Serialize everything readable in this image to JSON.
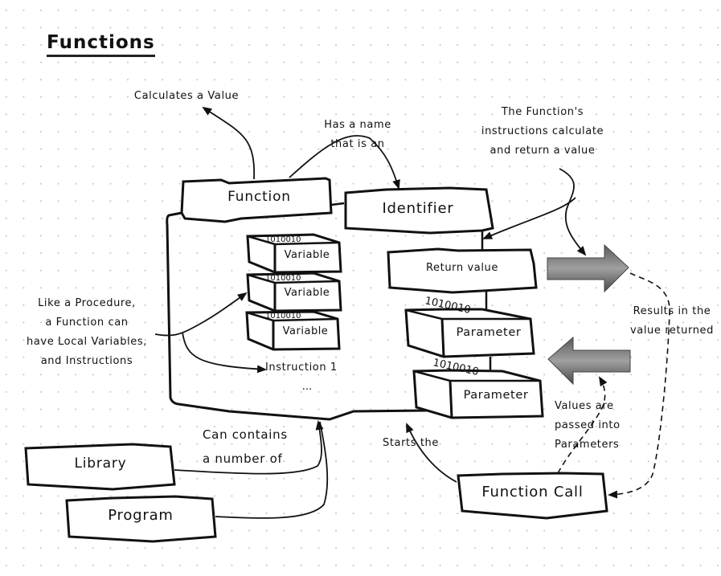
{
  "title": "Functions",
  "nodes": {
    "function": "Function",
    "identifier": "Identifier",
    "return_value": "Return value",
    "variables": [
      "Variable",
      "Variable",
      "Variable"
    ],
    "parameters": [
      "Parameter",
      "Parameter"
    ],
    "instruction": "Instruction 1",
    "ellipsis": "...",
    "library": "Library",
    "program": "Program",
    "function_call": "Function Call",
    "binary_label": "1010010"
  },
  "annotations": {
    "calculates": "Calculates a Value",
    "has_name": [
      "Has a name",
      "that is an"
    ],
    "instructions_calc": [
      "The Function's",
      "instructions calculate",
      "and return a value"
    ],
    "like_procedure": [
      "Like a Procedure,",
      "a Function can",
      "have Local Variables,",
      "and Instructions"
    ],
    "results": [
      "Results in the",
      "value returned"
    ],
    "values_passed": [
      "Values are",
      "passed into",
      "Parameters"
    ],
    "can_contain": [
      "Can contains",
      "a number of"
    ],
    "starts": "Starts the"
  },
  "colors": {
    "stroke": "#111111",
    "arrow_fill_light": "#9a9a9a",
    "arrow_fill_dark": "#555555"
  }
}
